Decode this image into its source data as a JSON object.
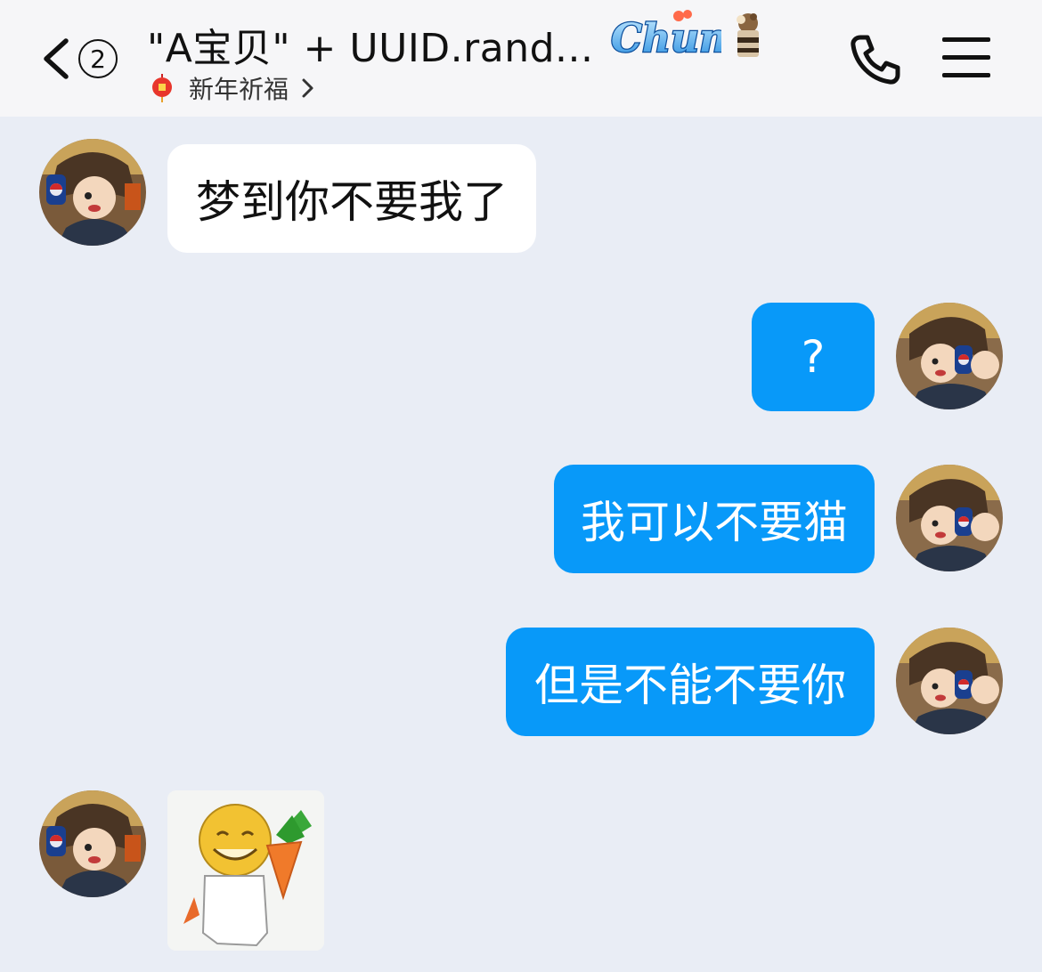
{
  "header": {
    "unread_count": "2",
    "title": "\"A宝贝\" + UUID.rand...",
    "subtitle": "新年祈福",
    "chum_badge_text": "Chum"
  },
  "messages": [
    {
      "side": "in",
      "type": "text",
      "text": "梦到你不要我了"
    },
    {
      "side": "out",
      "type": "text",
      "text": "?"
    },
    {
      "side": "out",
      "type": "text",
      "text": "我可以不要猫"
    },
    {
      "side": "out",
      "type": "text",
      "text": "但是不能不要你"
    },
    {
      "side": "in",
      "type": "sticker",
      "sticker": "smiling-face-with-carrot"
    }
  ],
  "colors": {
    "background": "#e9edf5",
    "header_bg": "#f6f6f8",
    "incoming_bubble": "#ffffff",
    "outgoing_bubble": "#0899f9"
  },
  "icons": {
    "back": "chevron-left-icon",
    "subtitle_icon": "lantern-icon",
    "phone": "phone-icon",
    "menu": "menu-icon",
    "decoration": "ice-cream-icon"
  }
}
